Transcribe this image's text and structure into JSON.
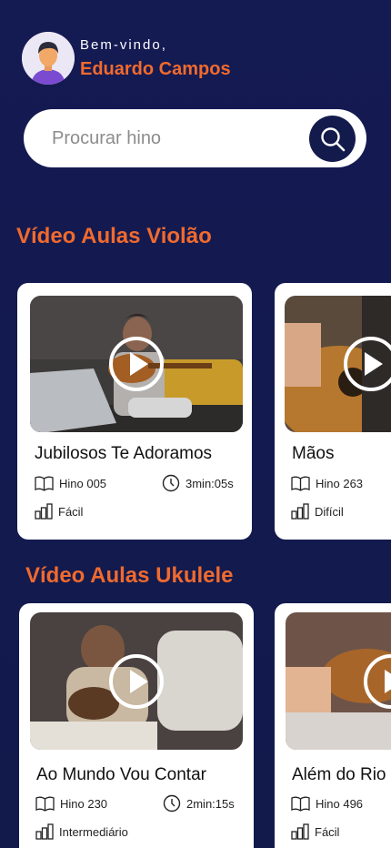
{
  "user": {
    "greeting": "Bem-vindo,",
    "name": "Eduardo Campos"
  },
  "search": {
    "placeholder": "Procurar hino"
  },
  "sections": [
    {
      "title": "Vídeo Aulas Violão",
      "cards": [
        {
          "title": "Jubilosos Te Adoramos",
          "hymn": "Hino 005",
          "duration": "3min:05s",
          "level": "Fácil"
        },
        {
          "title": "Mãos",
          "hymn": "Hino 263",
          "level": "Difícil"
        }
      ]
    },
    {
      "title": "Vídeo Aulas Ukulele",
      "cards": [
        {
          "title": "Ao Mundo Vou Contar",
          "hymn": "Hino 230",
          "duration": "2min:15s",
          "level": "Intermediário"
        },
        {
          "title": "Além do Rio",
          "hymn": "Hino 496",
          "level": "Fácil"
        }
      ]
    }
  ],
  "icons": {
    "search": "search-icon",
    "play": "play-icon",
    "book": "book-icon",
    "clock": "clock-icon",
    "level": "bar-chart-icon"
  },
  "colors": {
    "background": "#131a50",
    "accent": "#f06a2e",
    "card": "#ffffff"
  }
}
